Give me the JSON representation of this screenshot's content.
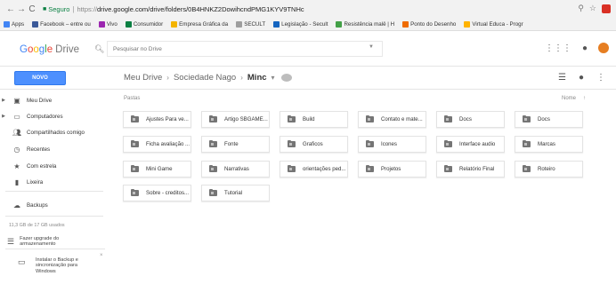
{
  "browser": {
    "secure_label": "Seguro",
    "url_scheme": "https://",
    "url_rest": "drive.google.com/drive/folders/0B4HNKZ2DowihcndPMG1KYV9TNHc",
    "bookmarks": [
      {
        "label": "Apps",
        "color": "#4285f4"
      },
      {
        "label": "Facebook – entre ou",
        "color": "#3b5998"
      },
      {
        "label": "Vivo",
        "color": "#9c27b0"
      },
      {
        "label": "Consumidor",
        "color": "#0b8043"
      },
      {
        "label": "Empresa Gráfica da",
        "color": "#f4b400"
      },
      {
        "label": "SECULT",
        "color": "#9e9e9e"
      },
      {
        "label": "Legislação - Secult",
        "color": "#1565c0"
      },
      {
        "label": "Resistência malê | H",
        "color": "#43a047"
      },
      {
        "label": "Ponto do Desenho",
        "color": "#ef6c00"
      },
      {
        "label": "Virtual Educa - Progr",
        "color": "#ffb300"
      }
    ]
  },
  "header": {
    "logo_g": [
      "G",
      "o",
      "o",
      "g",
      "l",
      "e"
    ],
    "logo_product": "Drive",
    "search_placeholder": "Pesquisar no Drive"
  },
  "toolbar": {
    "new_label": "NOVO",
    "breadcrumbs": [
      "Meu Drive",
      "Sociedade Nago",
      "Minc"
    ]
  },
  "sidebar": {
    "items": [
      {
        "label": "Meu Drive",
        "icon": "my-drive-icon"
      },
      {
        "label": "Computadores",
        "icon": "computer-icon"
      },
      {
        "label": "Compartilhados comigo",
        "icon": "people-icon"
      },
      {
        "label": "Recentes",
        "icon": "clock-icon"
      },
      {
        "label": "Com estrela",
        "icon": "star-icon"
      },
      {
        "label": "Lixeira",
        "icon": "trash-icon"
      },
      {
        "label": "Backups",
        "icon": "cloud-icon"
      }
    ],
    "quota": "11,3 GB de 17 GB usados",
    "upgrade_line1": "Fazer upgrade do",
    "upgrade_line2": "armazenamento",
    "backup_line1": "Instalar o Backup e",
    "backup_line2": "sincronização para",
    "backup_line3": "Windows"
  },
  "main": {
    "section_label": "Pastas",
    "sort_label": "Nome",
    "sort_arrow": "↑",
    "folders": [
      "Ajustes Para ve...",
      "Artigo SBGAME...",
      "Build",
      "Contato e mate...",
      "Docs",
      "Docs",
      "Ficha avaliação ...",
      "Fonte",
      "Graficos",
      "Icones",
      "Interface audio",
      "Marcas",
      "Mini Game",
      "Narrativas",
      "orientações ped...",
      "Projetos",
      "Relatório Final",
      "Roteiro",
      "Sobre - creditos...",
      "Tutorial"
    ]
  }
}
